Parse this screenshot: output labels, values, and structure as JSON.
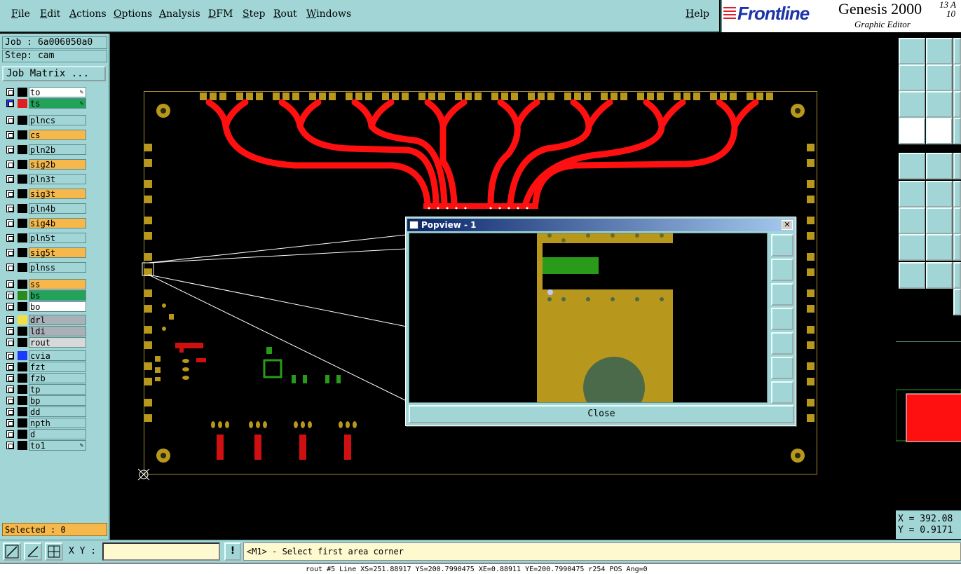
{
  "menubar": {
    "items": [
      "File",
      "Edit",
      "Actions",
      "Options",
      "Analysis",
      "DFM",
      "Step",
      "Rout",
      "Windows"
    ],
    "help": "Help"
  },
  "brand": {
    "logo": "Frontline",
    "product": "Genesis 2000",
    "subtitle": "Graphic Editor",
    "date_line1": "13 A",
    "date_line2": "10"
  },
  "job": {
    "job_label": "Job : 6a006050a0",
    "step_label": "Step: cam",
    "matrix_button": "Job Matrix ..."
  },
  "layers": [
    {
      "name": "to",
      "color": "#ffffff",
      "swatch": "#000000",
      "icon": "pen"
    },
    {
      "name": "ts",
      "color": "#22a35a",
      "swatch": "#e02020",
      "icon": "pen-grid",
      "active": true
    },
    {
      "name": "plncs",
      "color": "#a2d6d6",
      "swatch": "#000000"
    },
    {
      "name": "cs",
      "color": "#f6b84a",
      "swatch": "#000000"
    },
    {
      "name": "pln2b",
      "color": "#a2d6d6",
      "swatch": "#000000"
    },
    {
      "name": "sig2b",
      "color": "#f6b84a",
      "swatch": "#000000"
    },
    {
      "name": "pln3t",
      "color": "#a2d6d6",
      "swatch": "#000000"
    },
    {
      "name": "sig3t",
      "color": "#f6b84a",
      "swatch": "#000000"
    },
    {
      "name": "pln4b",
      "color": "#a2d6d6",
      "swatch": "#000000"
    },
    {
      "name": "sig4b",
      "color": "#f6b84a",
      "swatch": "#000000"
    },
    {
      "name": "pln5t",
      "color": "#a2d6d6",
      "swatch": "#000000"
    },
    {
      "name": "sig5t",
      "color": "#f6b84a",
      "swatch": "#000000"
    },
    {
      "name": "plnss",
      "color": "#a2d6d6",
      "swatch": "#000000"
    },
    {
      "name": "ss",
      "color": "#f6b84a",
      "swatch": "#000000"
    },
    {
      "name": "bs",
      "color": "#22a35a",
      "swatch": "#2a8a1a"
    },
    {
      "name": "bo",
      "color": "#ffffff",
      "swatch": "#000000"
    },
    {
      "name": "drl",
      "color": "#a8b0b8",
      "swatch": "#f0e040"
    },
    {
      "name": "ldi",
      "color": "#a8b0b8",
      "swatch": "#000000"
    },
    {
      "name": "rout",
      "color": "#d8d8d8",
      "swatch": "#000000"
    },
    {
      "name": "cvia",
      "color": "#a2d6d6",
      "swatch": "#1a3aff"
    },
    {
      "name": "fzt",
      "color": "#a2d6d6",
      "swatch": "#000000"
    },
    {
      "name": "fzb",
      "color": "#a2d6d6",
      "swatch": "#000000"
    },
    {
      "name": "tp",
      "color": "#a2d6d6",
      "swatch": "#000000"
    },
    {
      "name": "bp",
      "color": "#a2d6d6",
      "swatch": "#000000"
    },
    {
      "name": "dd",
      "color": "#a2d6d6",
      "swatch": "#000000"
    },
    {
      "name": "npth",
      "color": "#a2d6d6",
      "swatch": "#000000"
    },
    {
      "name": "d",
      "color": "#a2d6d6",
      "swatch": "#000000"
    },
    {
      "name": "to1",
      "color": "#a2d6d6",
      "swatch": "#000000",
      "icon": "pen"
    }
  ],
  "selected_label": "Selected : 0",
  "popview": {
    "title": "Popview - 1",
    "close_label": "Close"
  },
  "coords": {
    "x": "X = 392.08",
    "y": "Y = 0.9171"
  },
  "bottom": {
    "xy_label": "X Y :",
    "xy_value": "",
    "warn_label": "!",
    "prompt": "<M1> - Select first area corner"
  },
  "status_line": "rout #5 Line XS=251.88917 YS=200.7990475 XE=0.88911 YE=200.7990475 r254 POS Ang=0",
  "colors": {
    "panel": "#a2d6d6",
    "trace": "#ff1010",
    "pad": "#b8981c",
    "green": "#2a9a1a",
    "accent": "#f6b84a"
  }
}
